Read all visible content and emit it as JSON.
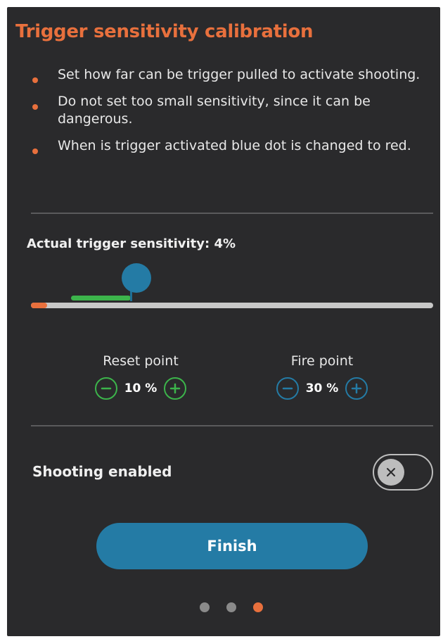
{
  "title": "Trigger sensitivity calibration",
  "instructions": [
    "Set how far can be trigger pulled to activate shooting.",
    "Do not set too small sensitivity, since it can be dangerous.",
    "When is trigger activated blue dot is changed to red."
  ],
  "sensitivity": {
    "label": "Actual trigger sensitivity: 4%",
    "actual_percent": 4,
    "reset_percent": 10,
    "fire_percent": 30
  },
  "reset_point": {
    "label": "Reset point",
    "value": "10 %"
  },
  "fire_point": {
    "label": "Fire point",
    "value": "30 %"
  },
  "shooting": {
    "label": "Shooting enabled",
    "enabled": false
  },
  "finish_label": "Finish",
  "pager": {
    "count": 3,
    "active": 2
  },
  "colors": {
    "accent": "#e8703d",
    "primary": "#247ba5",
    "reset": "#3cb44b",
    "track": "#c8c8c8",
    "background": "#2a2a2c"
  },
  "icons": {
    "decrement": "minus-circle-icon",
    "increment": "plus-circle-icon",
    "toggle_off": "close-icon"
  }
}
